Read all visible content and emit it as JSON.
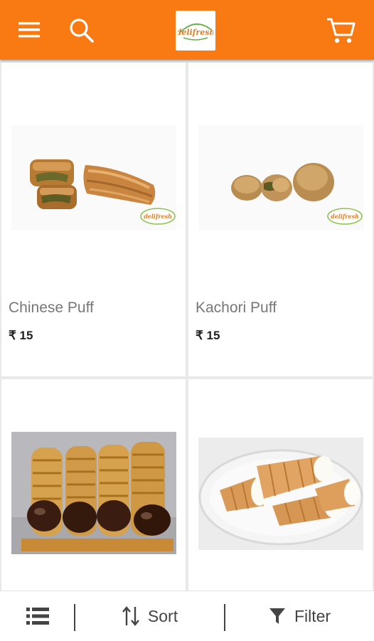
{
  "header": {
    "menu_icon": "hamburger-menu-icon",
    "search_icon": "search-icon",
    "cart_icon": "shopping-cart-icon",
    "logo_text": "delifresh",
    "brand_color": "#f97a12"
  },
  "products": [
    {
      "name": "Chinese Puff",
      "price": "₹ 15"
    },
    {
      "name": "Kachori Puff",
      "price": "₹ 15"
    },
    {
      "name": "",
      "price": ""
    },
    {
      "name": "",
      "price": ""
    }
  ],
  "bottom_bar": {
    "view_icon": "list-view-icon",
    "sort_label": "Sort",
    "sort_icon": "sort-arrows-icon",
    "filter_label": "Filter",
    "filter_icon": "filter-funnel-icon"
  }
}
